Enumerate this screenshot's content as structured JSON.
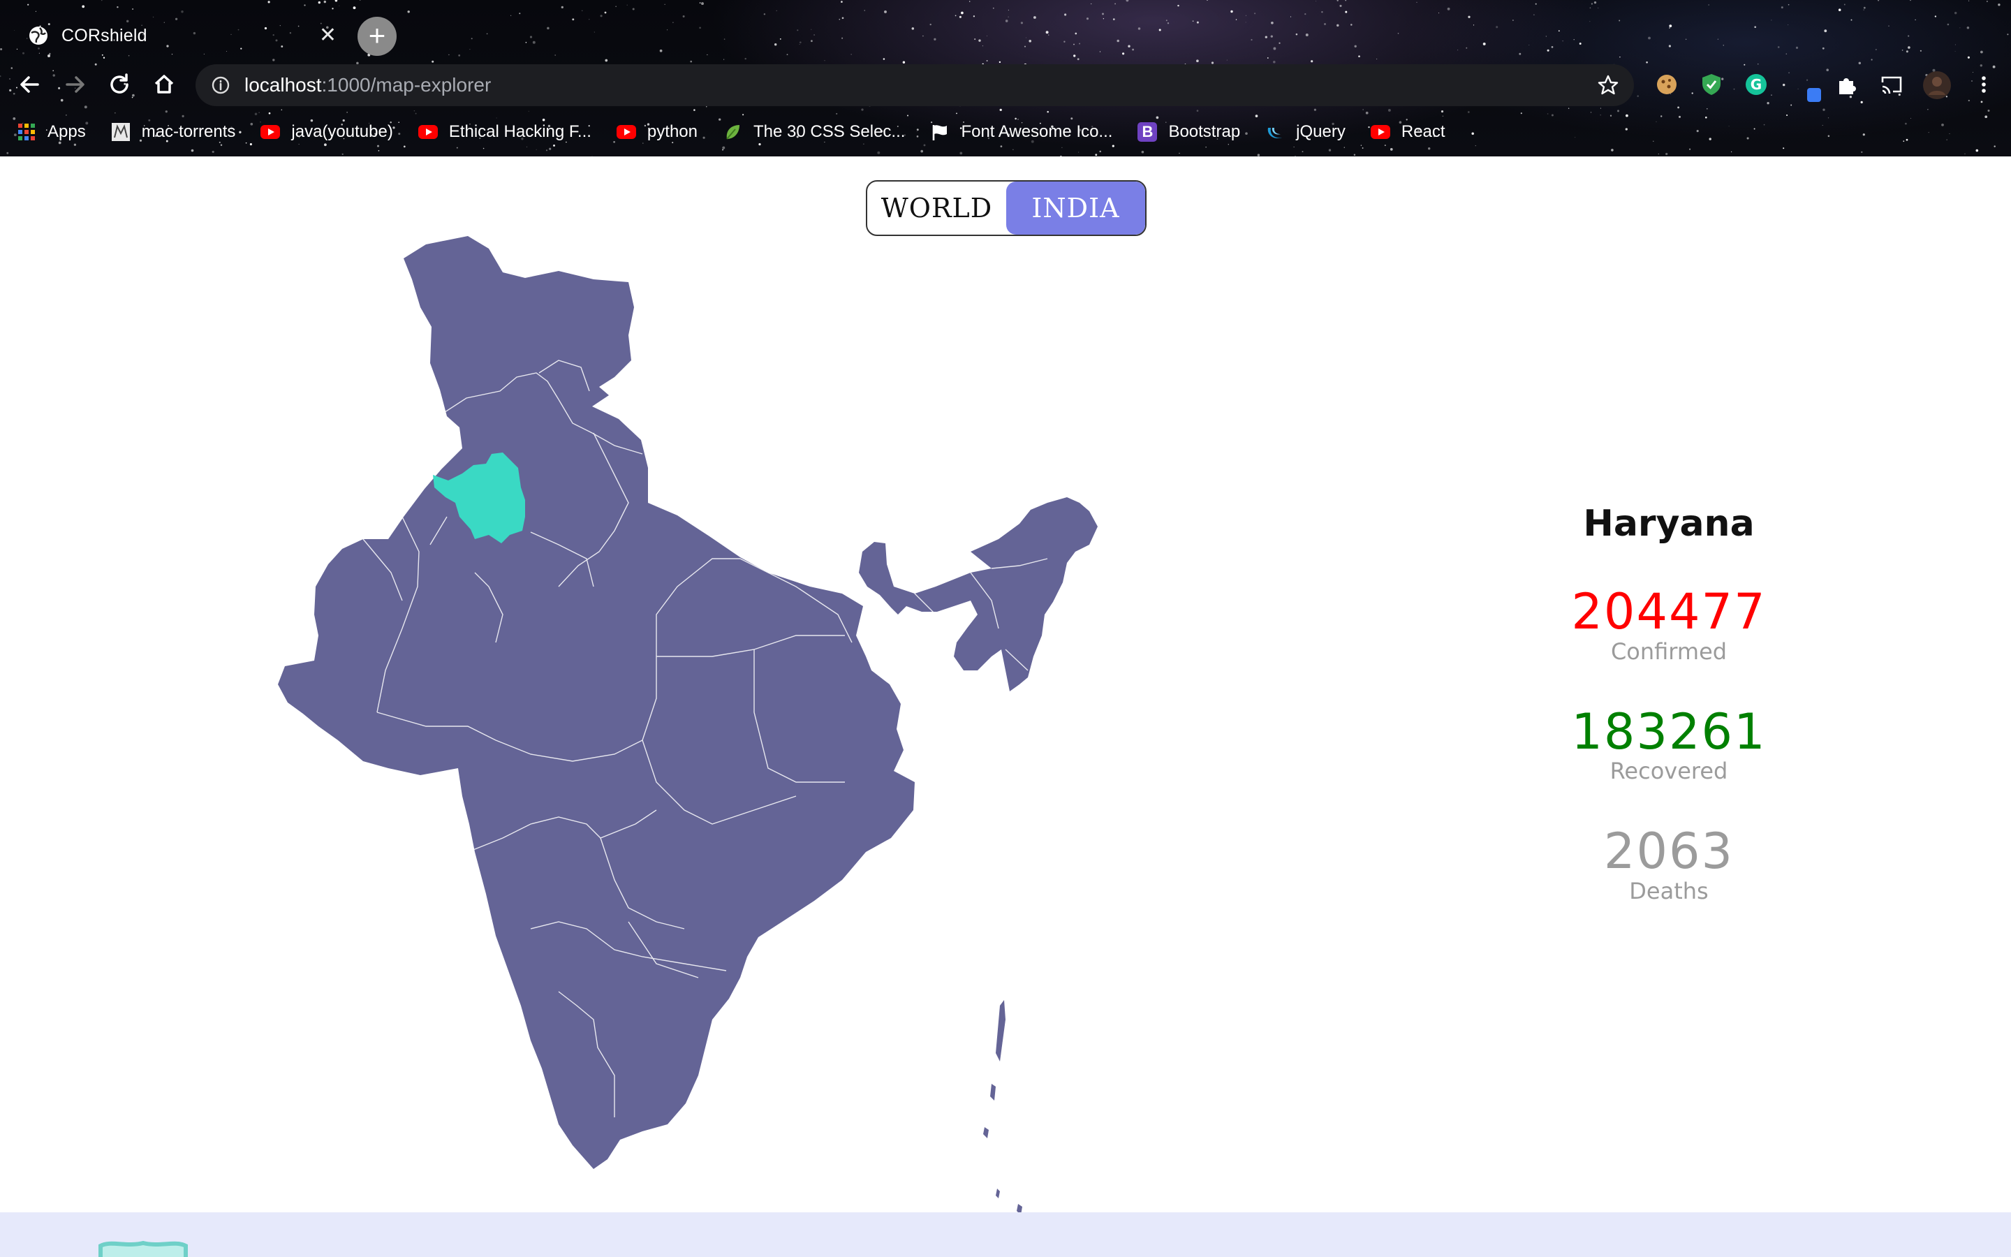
{
  "browser": {
    "tab_title": "CORshield",
    "url_host": "localhost",
    "url_path": ":1000/map-explorer",
    "bookmarks": [
      {
        "label": "Apps",
        "icon": "apps-grid-icon"
      },
      {
        "label": "mac-torrents",
        "icon": "mac-torrents-icon"
      },
      {
        "label": "java(youtube)",
        "icon": "youtube-icon"
      },
      {
        "label": "Ethical Hacking F...",
        "icon": "youtube-icon"
      },
      {
        "label": "python",
        "icon": "youtube-icon"
      },
      {
        "label": "The 30 CSS Selec...",
        "icon": "leaf-icon"
      },
      {
        "label": "Font Awesome Ico...",
        "icon": "flag-icon"
      },
      {
        "label": "Bootstrap",
        "icon": "bootstrap-icon"
      },
      {
        "label": "jQuery",
        "icon": "jquery-icon"
      },
      {
        "label": "React",
        "icon": "youtube-icon"
      }
    ]
  },
  "toggle": {
    "world_label": "WORLD",
    "india_label": "INDIA",
    "active": "INDIA",
    "active_color": "#7a7fe6"
  },
  "map": {
    "region": "India",
    "base_color": "#646496",
    "highlight_color": "#3ad9c4",
    "highlighted_state": "Haryana"
  },
  "stats": {
    "state_name": "Haryana",
    "confirmed": {
      "value": "204477",
      "label": "Confirmed",
      "color": "#ff0000"
    },
    "recovered": {
      "value": "183261",
      "label": "Recovered",
      "color": "#008000"
    },
    "deaths": {
      "value": "2063",
      "label": "Deaths",
      "color": "#9b9b9b"
    }
  }
}
